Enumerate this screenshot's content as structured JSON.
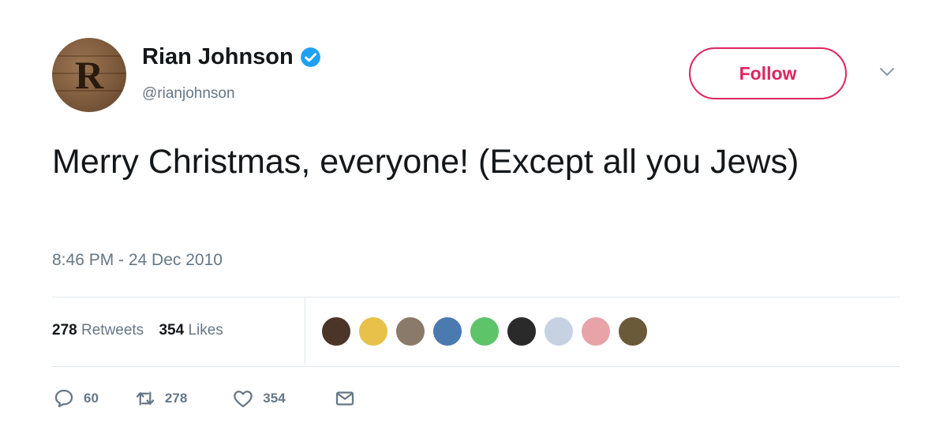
{
  "tweet": {
    "avatar_letter": "R",
    "display_name": "Rian Johnson",
    "handle": "@rianjohnson",
    "verified": true,
    "follow_label": "Follow",
    "text": "Merry Christmas, everyone! (Except all you Jews)",
    "timestamp": "8:46 PM - 24 Dec 2010"
  },
  "stats": {
    "retweets_count": "278",
    "retweets_label": "Retweets",
    "likes_count": "354",
    "likes_label": "Likes"
  },
  "likers": [
    "#4a3528",
    "#e8c14a",
    "#8a7a6a",
    "#4a7ab0",
    "#5ec46a",
    "#2a2a2a",
    "#c6d2e2",
    "#e8a3a8",
    "#6a5a3a"
  ],
  "actions": {
    "replies": "60",
    "retweets": "278",
    "likes": "354"
  },
  "colors": {
    "follow_accent": "#e0245e",
    "verified_blue": "#1da1f2",
    "secondary_text": "#657786"
  }
}
